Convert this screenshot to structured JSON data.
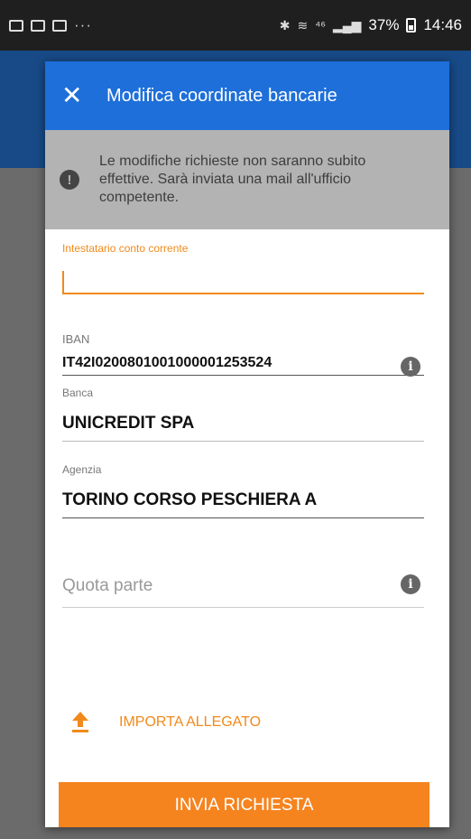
{
  "status_bar": {
    "left_dots": "···",
    "network": "⁴⁶",
    "battery_percent": "37%",
    "time": "14:46"
  },
  "dialog": {
    "close_icon": "close-icon",
    "title": "Modifica coordinate bancarie",
    "notice": {
      "icon": "alert-icon",
      "text": "Le modifiche richieste non saranno subito effettive. Sarà inviata una mail all'ufficio competente."
    },
    "fields": {
      "intestatario": {
        "label": "Intestatario conto corrente",
        "value": ""
      },
      "iban": {
        "label": "IBAN",
        "value": "IT42I0200801001000001253524",
        "icon": "info-icon"
      },
      "banca": {
        "label": "Banca",
        "value": "UNICREDIT SPA"
      },
      "agenzia": {
        "label": "Agenzia",
        "value": "TORINO CORSO PESCHIERA A"
      },
      "quota_parte": {
        "placeholder": "Quota parte",
        "icon": "info-icon"
      }
    },
    "upload": {
      "icon": "upload-icon",
      "label": "IMPORTA ALLEGATO"
    },
    "submit": {
      "label": "INVIA RICHIESTA"
    }
  },
  "colors": {
    "header_blue": "#1e6fd9",
    "accent_orange": "#f5841f",
    "notice_gray": "#b3b3b3"
  }
}
